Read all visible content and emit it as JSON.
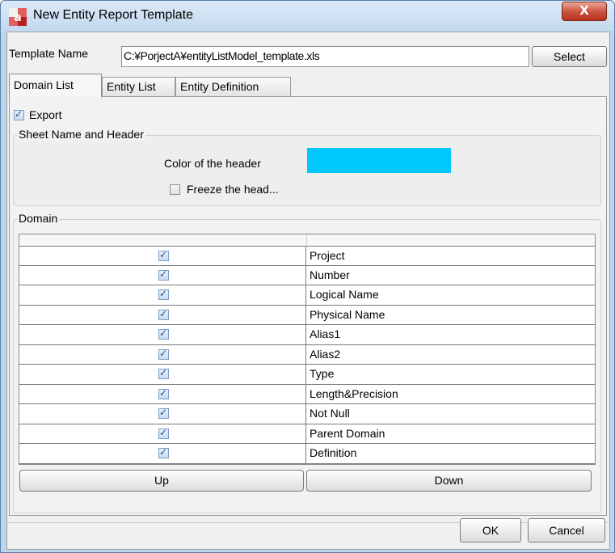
{
  "window": {
    "title": "New Entity Report Template",
    "close_label": "X",
    "app_icon": "a5m2-app-icon"
  },
  "template": {
    "label": "Template Name",
    "value": "C:¥PorjectA¥entityListModel_template.xls",
    "select_label": "Select"
  },
  "tabs": [
    {
      "label": "Domain List",
      "active": true
    },
    {
      "label": "Entity List",
      "active": false
    },
    {
      "label": "Entity Definition",
      "active": false
    }
  ],
  "export": {
    "label": "Export",
    "checked": true
  },
  "sheet_group": {
    "title": "Sheet Name and Header",
    "color_label": "Color of the header",
    "header_color": "#00c8ff",
    "freeze_label": "Freeze the head...",
    "freeze_checked": false
  },
  "domain_group": {
    "title": "Domain",
    "rows": [
      {
        "label": "Project",
        "checked": true
      },
      {
        "label": "Number",
        "checked": true
      },
      {
        "label": "Logical Name",
        "checked": true
      },
      {
        "label": "Physical Name",
        "checked": true
      },
      {
        "label": "Alias1",
        "checked": true
      },
      {
        "label": "Alias2",
        "checked": true
      },
      {
        "label": "Type",
        "checked": true
      },
      {
        "label": "Length&Precision",
        "checked": true
      },
      {
        "label": "Not Null",
        "checked": true
      },
      {
        "label": "Parent Domain",
        "checked": true
      },
      {
        "label": "Definition",
        "checked": true
      }
    ],
    "up_label": "Up",
    "down_label": "Down"
  },
  "footer": {
    "ok_label": "OK",
    "cancel_label": "Cancel"
  }
}
